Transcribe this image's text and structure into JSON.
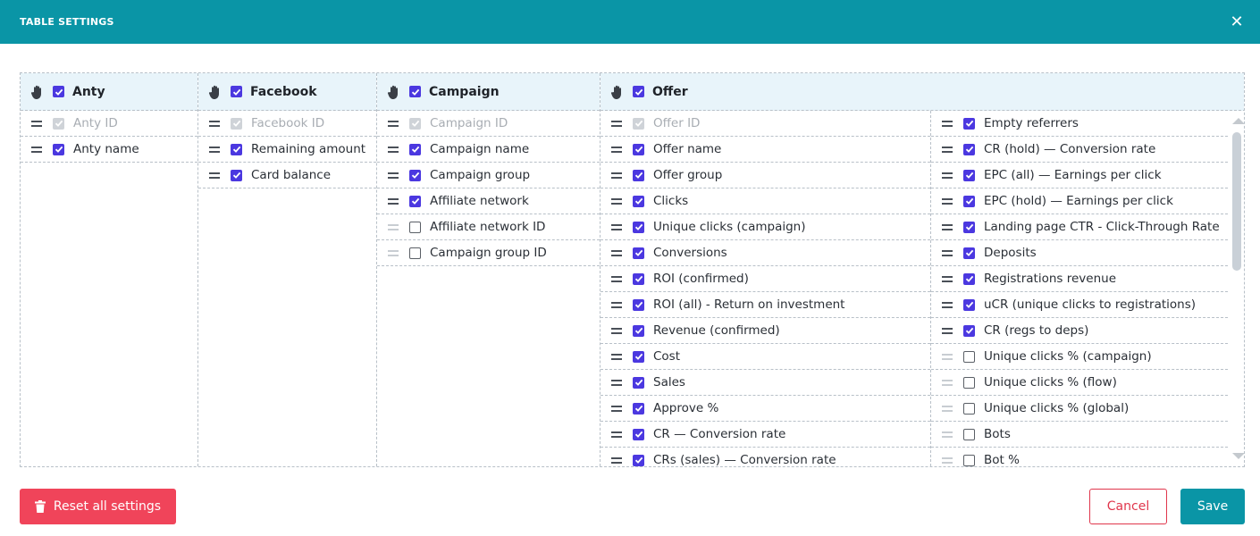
{
  "dialog": {
    "title": "TABLE SETTINGS",
    "close_icon": "close-icon"
  },
  "columns": [
    {
      "title": "Anty",
      "checked": true,
      "rows": [
        {
          "label": "Anty ID",
          "state": "disabled"
        },
        {
          "label": "Anty name",
          "state": "on"
        }
      ]
    },
    {
      "title": "Facebook",
      "checked": true,
      "rows": [
        {
          "label": "Facebook ID",
          "state": "disabled"
        },
        {
          "label": "Remaining amount",
          "state": "on"
        },
        {
          "label": "Card balance",
          "state": "on"
        }
      ]
    },
    {
      "title": "Campaign",
      "checked": true,
      "rows": [
        {
          "label": "Campaign ID",
          "state": "disabled"
        },
        {
          "label": "Campaign name",
          "state": "on"
        },
        {
          "label": "Campaign group",
          "state": "on"
        },
        {
          "label": "Affiliate network",
          "state": "on"
        },
        {
          "label": "Affiliate network ID",
          "state": "off"
        },
        {
          "label": "Campaign group ID",
          "state": "off"
        }
      ]
    },
    {
      "title": "Offer",
      "checked": true,
      "rows": [
        {
          "label": "Offer ID",
          "state": "disabled"
        },
        {
          "label": "Offer name",
          "state": "on"
        },
        {
          "label": "Offer group",
          "state": "on"
        },
        {
          "label": "Clicks",
          "state": "on"
        },
        {
          "label": "Unique clicks (campaign)",
          "state": "on"
        },
        {
          "label": "Conversions",
          "state": "on"
        },
        {
          "label": "ROI (confirmed)",
          "state": "on"
        },
        {
          "label": "ROI (all) - Return on investment",
          "state": "on"
        },
        {
          "label": "Revenue (confirmed)",
          "state": "on"
        },
        {
          "label": "Cost",
          "state": "on"
        },
        {
          "label": "Sales",
          "state": "on"
        },
        {
          "label": "Approve %",
          "state": "on"
        },
        {
          "label": "CR — Conversion rate",
          "state": "on"
        },
        {
          "label": "CRs (sales) — Conversion rate",
          "state": "on"
        }
      ],
      "rows_right": [
        {
          "label": "Empty referrers",
          "state": "on"
        },
        {
          "label": "CR (hold) — Conversion rate",
          "state": "on"
        },
        {
          "label": "EPC (all) — Earnings per click",
          "state": "on"
        },
        {
          "label": "EPC (hold) — Earnings per click",
          "state": "on"
        },
        {
          "label": "Landing page CTR - Click-Through Rate",
          "state": "on"
        },
        {
          "label": "Deposits",
          "state": "on"
        },
        {
          "label": "Registrations revenue",
          "state": "on"
        },
        {
          "label": "uCR (unique clicks to registrations)",
          "state": "on"
        },
        {
          "label": "CR (regs to deps)",
          "state": "on"
        },
        {
          "label": "Unique clicks % (campaign)",
          "state": "off"
        },
        {
          "label": "Unique clicks % (flow)",
          "state": "off"
        },
        {
          "label": "Unique clicks % (global)",
          "state": "off"
        },
        {
          "label": "Bots",
          "state": "off"
        },
        {
          "label": "Bot %",
          "state": "off"
        }
      ]
    }
  ],
  "footer": {
    "reset_label": "Reset all settings",
    "cancel_label": "Cancel",
    "save_label": "Save"
  },
  "colors": {
    "accent": "#0a95a6",
    "checkbox": "#4b38e0",
    "danger": "#f0445a"
  }
}
